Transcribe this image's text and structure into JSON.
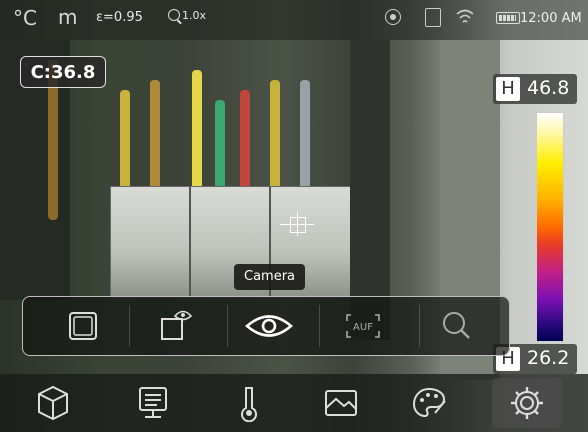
{
  "status": {
    "unit": "°C",
    "mode": "m",
    "emissivity": "ε=0.95",
    "zoom": "1.0x",
    "time": "12:00 AM",
    "icons": [
      "record-icon",
      "sd-card-icon",
      "wifi-icon",
      "battery-icon"
    ]
  },
  "center_readout": "C:36.8",
  "scale": {
    "high_tag": "H",
    "high_value": "46.8",
    "low_tag": "H",
    "low_value": "26.2",
    "palette": "iron"
  },
  "tooltip": "Camera",
  "quickbar": {
    "items": [
      {
        "icon": "image-mode-fullscreen-icon",
        "active": false
      },
      {
        "icon": "picture-in-picture-icon",
        "active": false
      },
      {
        "icon": "camera-eye-icon",
        "active": true
      },
      {
        "icon": "auto-focus-icon",
        "label": "AUF",
        "active": false
      },
      {
        "icon": "zoom-icon",
        "active": false
      }
    ]
  },
  "bottom_menu": {
    "items": [
      "package-icon",
      "monitor-icon",
      "thermometer-icon",
      "image-icon",
      "palette-icon",
      "settings-gear-icon"
    ]
  },
  "colors": {
    "text": "#ffffff",
    "bar_background": "#1e201e",
    "outline": "#bdbdbd"
  }
}
